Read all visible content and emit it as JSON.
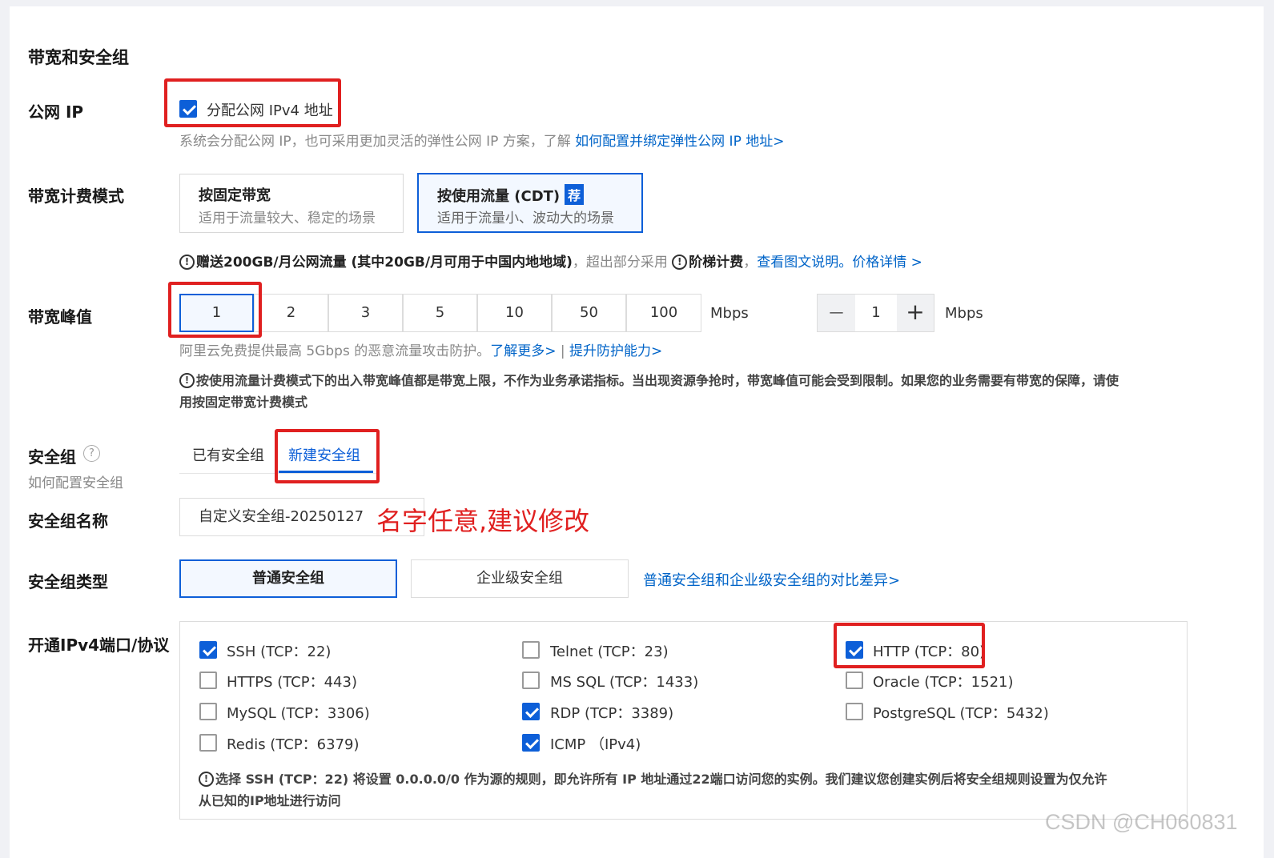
{
  "section_title": "带宽和安全组",
  "public_ip": {
    "label": "公网 IP",
    "checkbox_label": "分配公网 IPv4 地址",
    "checked": true,
    "hint": "系统会分配公网 IP，也可采用更加灵活的弹性公网 IP 方案，了解 ",
    "hint_link": "如何配置并绑定弹性公网 IP 地址>"
  },
  "billing": {
    "label": "带宽计费模式",
    "options": [
      {
        "title": "按固定带宽",
        "subtitle": "适用于流量较大、稳定的场景",
        "badge": ""
      },
      {
        "title": "按使用流量 (CDT)",
        "subtitle": "适用于流量小、波动大的场景",
        "badge": "荐"
      }
    ],
    "selected": 1,
    "note_icon": "!",
    "note_bold": "赠送200GB/月公网流量 (其中20GB/月可用于中国内地地域)",
    "note_plain": "，超出部分采用 ",
    "note_bold2": "阶梯计费",
    "note_sep": "，",
    "note_link1": "查看图文说明。",
    "note_link2": "价格详情 >"
  },
  "bandwidth_peak": {
    "label": "带宽峰值",
    "options": [
      "1",
      "2",
      "3",
      "5",
      "10",
      "50",
      "100"
    ],
    "selected": 0,
    "unit": "Mbps",
    "stepper_minus": "—",
    "stepper_value": "1",
    "stepper_plus": "+",
    "stepper_unit": "Mbps",
    "hint": "阿里云免费提供最高 5Gbps 的恶意流量攻击防护。",
    "hint_link1": "了解更多>",
    "hint_sep": " | ",
    "hint_link2": "提升防护能力>",
    "warning_line1": "按使用流量计费模式下的出入带宽峰值都是带宽上限，不作为业务承诺指标。当出现资源争抢时，带宽峰值可能会受到限制。如果您的业务需要有带宽的保障，请使",
    "warning_line2": "用按固定带宽计费模式"
  },
  "security_group": {
    "label": "安全组",
    "help_icon": "?",
    "sublabel": "如何配置安全组",
    "tabs": [
      "已有安全组",
      "新建安全组"
    ],
    "active_tab": 1
  },
  "sg_name": {
    "label": "安全组名称",
    "value": "自定义安全组-20250127",
    "annotation": "名字任意,建议修改"
  },
  "sg_type": {
    "label": "安全组类型",
    "options": [
      "普通安全组",
      "企业级安全组"
    ],
    "selected": 0,
    "compare_link": "普通安全组和企业级安全组的对比差异>"
  },
  "ports": {
    "label": "开通IPv4端口/协议",
    "items": [
      {
        "label": "SSH (TCP：22)",
        "checked": true
      },
      {
        "label": "Telnet (TCP：23)",
        "checked": false
      },
      {
        "label": "HTTP (TCP：80)",
        "checked": true
      },
      {
        "label": "HTTPS (TCP：443)",
        "checked": false
      },
      {
        "label": "MS SQL (TCP：1433)",
        "checked": false
      },
      {
        "label": "Oracle (TCP：1521)",
        "checked": false
      },
      {
        "label": "MySQL (TCP：3306)",
        "checked": false
      },
      {
        "label": "RDP (TCP：3389)",
        "checked": true
      },
      {
        "label": "PostgreSQL (TCP：5432)",
        "checked": false
      },
      {
        "label": "Redis (TCP：6379)",
        "checked": false
      },
      {
        "label": "ICMP （IPv4)",
        "checked": true
      }
    ],
    "warning_line1": "选择 SSH (TCP：22) 将设置 0.0.0.0/0 作为源的规则，即允许所有 IP 地址通过22端口访问您的实例。我们建议您创建实例后将安全组规则设置为仅允许",
    "warning_line2": "从已知的IP地址进行访问"
  },
  "watermark": "CSDN @CH060831",
  "colors": {
    "accent": "#0d5fd8",
    "annotation_red": "#e02020",
    "link": "#0064c8"
  }
}
